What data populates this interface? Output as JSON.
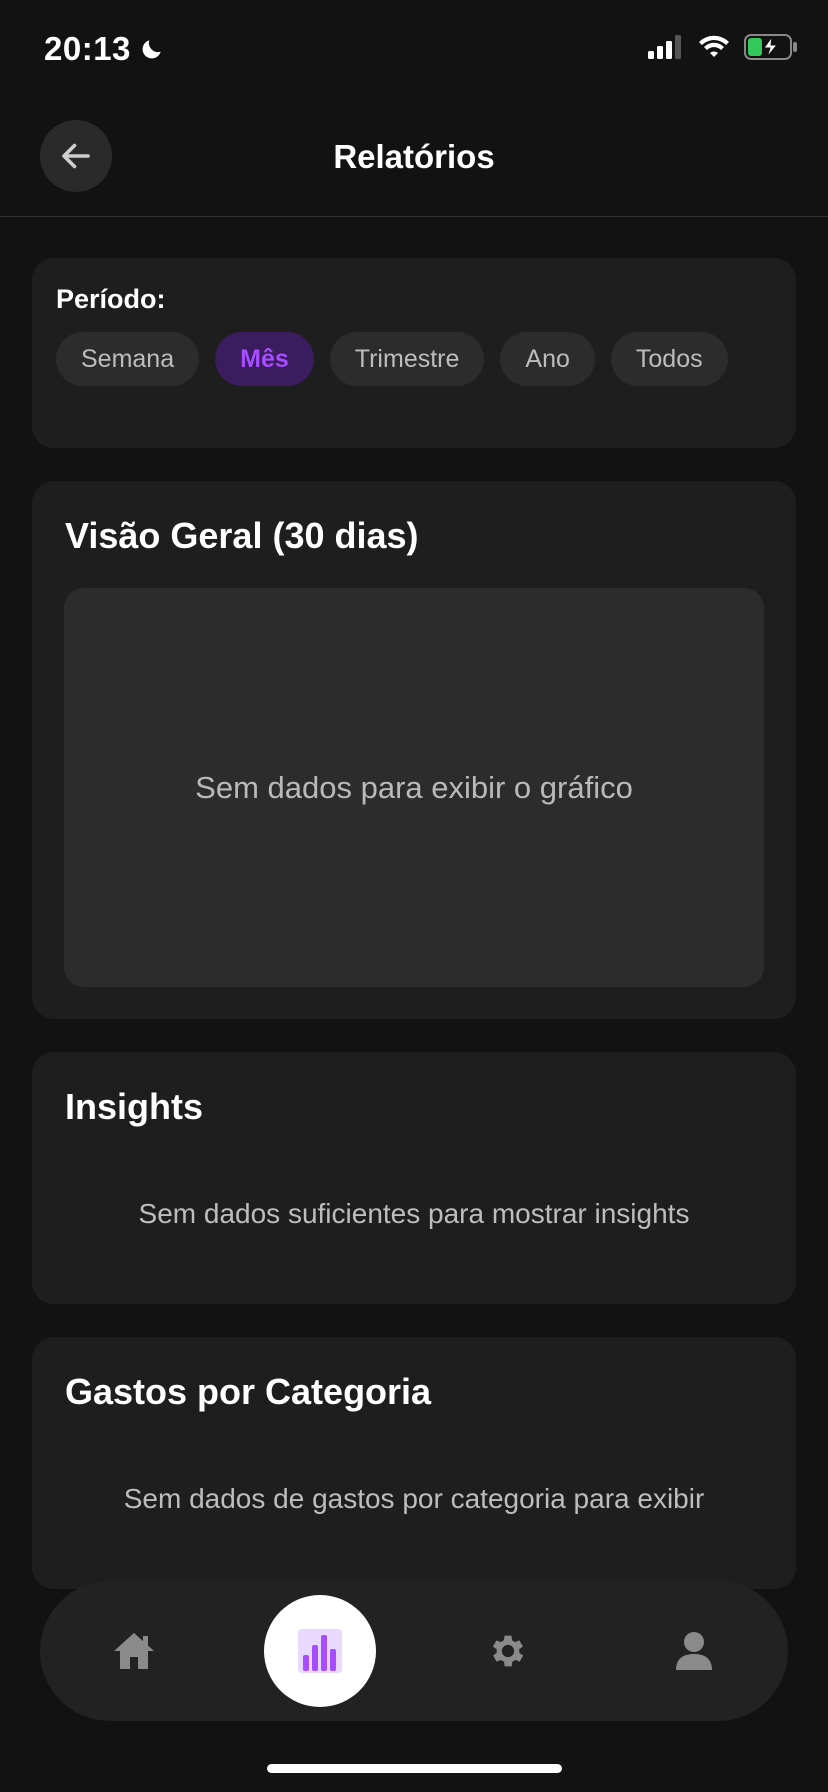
{
  "status_bar": {
    "time": "20:13",
    "icons": [
      "moon-icon",
      "signal-icon",
      "wifi-icon",
      "battery-charging-icon"
    ]
  },
  "header": {
    "title": "Relatórios",
    "back_icon": "arrow-left-icon"
  },
  "period": {
    "label": "Período:",
    "options": [
      "Semana",
      "Mês",
      "Trimestre",
      "Ano",
      "Todos"
    ],
    "selected": "Mês"
  },
  "overview": {
    "title": "Visão Geral (30 dias)",
    "empty_message": "Sem dados para exibir o gráfico"
  },
  "insights": {
    "title": "Insights",
    "empty_message": "Sem dados suficientes para mostrar insights"
  },
  "category": {
    "title": "Gastos por Categoria",
    "empty_message": "Sem dados de gastos por categoria para exibir"
  },
  "bottom_nav": {
    "items": [
      {
        "icon": "home-icon",
        "active": false
      },
      {
        "icon": "bar-chart-icon",
        "active": true
      },
      {
        "icon": "gear-icon",
        "active": false
      },
      {
        "icon": "user-icon",
        "active": false
      }
    ]
  },
  "colors": {
    "background": "#121212",
    "card": "#1e1e1e",
    "accent": "#a64dff",
    "accent_bg": "#3b1c5e",
    "battery_green": "#34c759"
  }
}
